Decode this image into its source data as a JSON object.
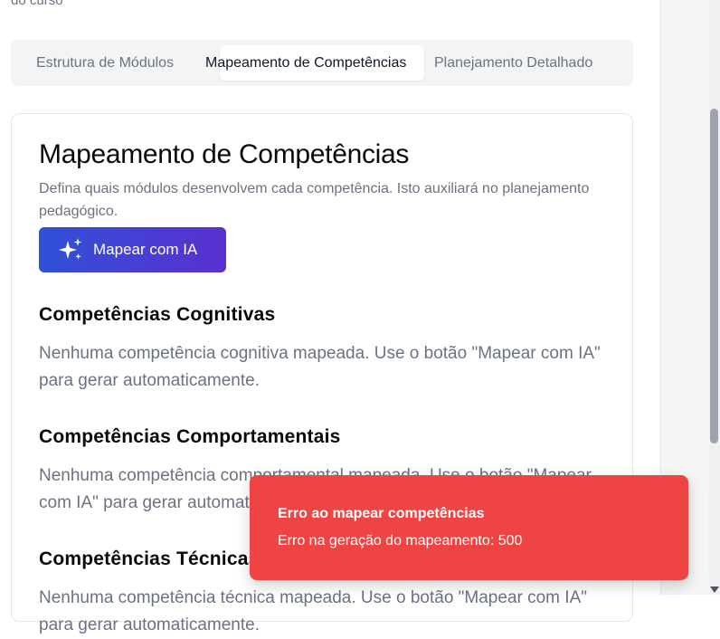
{
  "top_partial_text": "do curso",
  "tabs": [
    {
      "label": "Estrutura de Módulos"
    },
    {
      "label": "Mapeamento de Competências"
    },
    {
      "label": "Planejamento Detalhado"
    }
  ],
  "card": {
    "title": "Mapeamento de Competências",
    "description": "Defina quais módulos desenvolvem cada competência. Isto auxiliará no planejamento pedagógico.",
    "ai_button": {
      "label": "Mapear com IA",
      "icon": "sparkles-icon"
    }
  },
  "sections": [
    {
      "title": "Competências Cognitivas",
      "text": "Nenhuma competência cognitiva mapeada. Use o botão \"Mapear com IA\" para gerar automaticamente."
    },
    {
      "title": "Competências Comportamentais",
      "text": "Nenhuma competência comportamental mapeada. Use o botão \"Mapear com IA\" para gerar automaticamente."
    },
    {
      "title": "Competências Técnicas",
      "text": "Nenhuma competência técnica mapeada. Use o botão \"Mapear com IA\" para gerar automaticamente."
    }
  ],
  "toast": {
    "title": "Erro ao mapear competências",
    "message": "Erro na geração do mapeamento: 500",
    "color": "#ef4444"
  },
  "colors": {
    "accent_start": "#2f51d8",
    "accent_end": "#5b2fd0"
  }
}
